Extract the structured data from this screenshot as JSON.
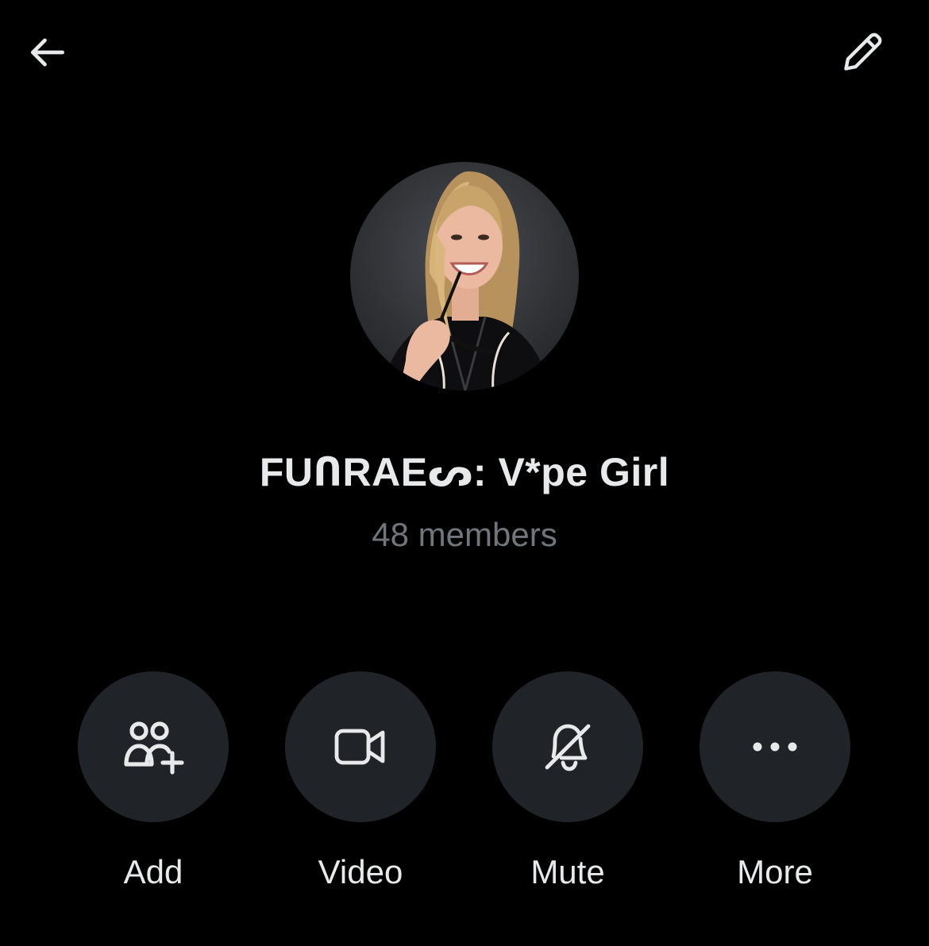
{
  "header": {
    "back_icon": "arrow-left-icon",
    "edit_icon": "pencil-icon"
  },
  "group": {
    "name": "FUՈRAEᔕ: V*pe Girl",
    "members": "48 members"
  },
  "actions": [
    {
      "label": "Add",
      "icon": "add-people-icon"
    },
    {
      "label": "Video",
      "icon": "video-camera-icon"
    },
    {
      "label": "Mute",
      "icon": "bell-off-icon"
    },
    {
      "label": "More",
      "icon": "more-horizontal-icon"
    }
  ],
  "colors": {
    "background": "#000000",
    "primary_text": "#e7e9ea",
    "secondary_text": "#71767b",
    "button_bg": "#202327"
  }
}
